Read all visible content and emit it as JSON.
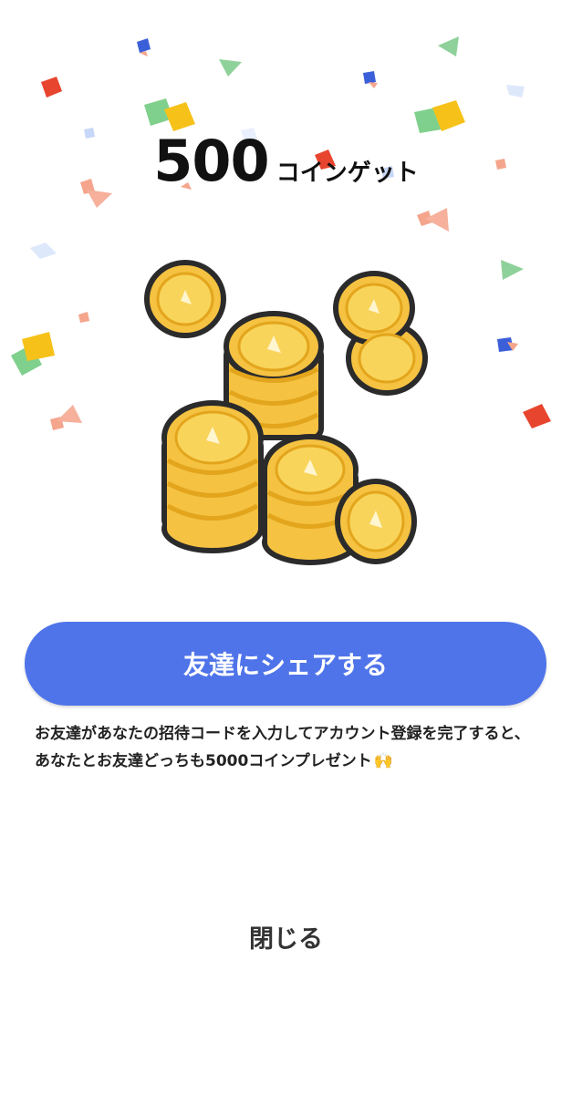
{
  "reward": {
    "amount": "500",
    "suffix": "コインゲット"
  },
  "share_button": {
    "label": "友達にシェアする"
  },
  "description": {
    "text": "お友達があなたの招待コードを入力してアカウント登録を完了すると、 あなたとお友達どっちも5000コインプレゼント",
    "emoji": "🙌"
  },
  "close": {
    "label": "閉じる"
  },
  "icons": {
    "illustration": "gold-coins-pile-icon",
    "confetti": "confetti-icon",
    "emoji": "raised-hands-icon"
  },
  "colors": {
    "accent": "#4f74ea",
    "coin": "#f5c242",
    "coin_rim": "#e8a81e"
  }
}
